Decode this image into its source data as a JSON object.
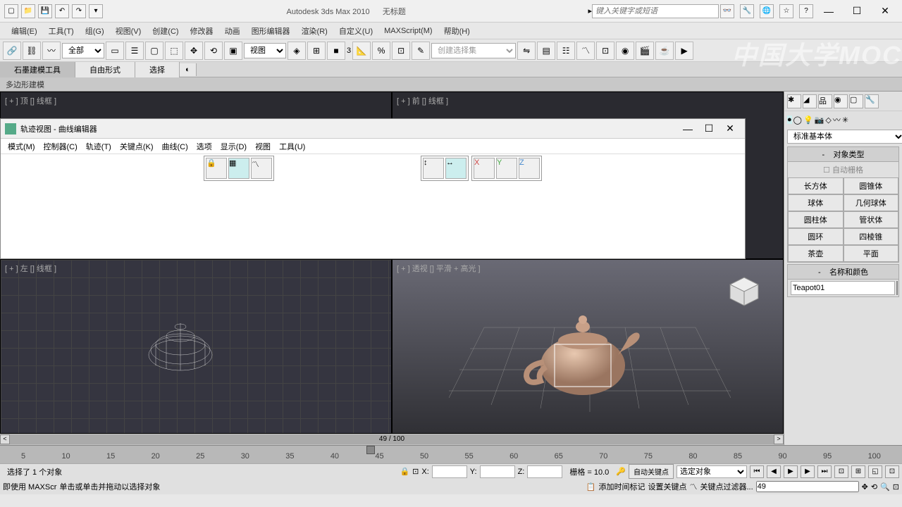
{
  "titlebar": {
    "app": "Autodesk 3ds Max  2010",
    "doc": "无标题",
    "search_placeholder": "键入关键字或短语"
  },
  "menu": {
    "edit": "编辑(E)",
    "tools": "工具(T)",
    "group": "组(G)",
    "views": "视图(V)",
    "create": "创建(C)",
    "modifiers": "修改器",
    "anim": "动画",
    "graph": "图形编辑器",
    "render": "渲染(R)",
    "custom": "自定义(U)",
    "maxscript": "MAXScript(M)",
    "help": "帮助(H)"
  },
  "toolbar": {
    "filter": "全部",
    "view_combo": "视图",
    "selset": "创建选择集"
  },
  "ribbon": {
    "tab1": "石墨建模工具",
    "tab2": "自由形式",
    "tab3": "选择",
    "sub": "多边形建模"
  },
  "viewports": {
    "top": "[ + ] 顶 [] 线框 ]",
    "front": "[ + ] 前 [] 线框 ]",
    "left": "[ + ] 左 [] 线框 ]",
    "persp": "[ + ] 透视 [] 平滑 + 高光 ]"
  },
  "curve_editor": {
    "title": "轨迹视图 - 曲线编辑器",
    "menu": {
      "mode": "模式(M)",
      "controller": "控制器(C)",
      "tracks": "轨迹(T)",
      "keys": "关键点(K)",
      "curves": "曲线(C)",
      "options": "选项",
      "display": "显示(D)",
      "view": "视图",
      "tools": "工具(U)"
    }
  },
  "time_scroll": "49 / 100",
  "right_panel": {
    "category": "标准基本体",
    "sec_objtype": "对象类型",
    "autogrid": "自动栅格",
    "primitives": {
      "box": "长方体",
      "cone": "圆锥体",
      "sphere": "球体",
      "geosphere": "几何球体",
      "cylinder": "圆柱体",
      "tube": "管状体",
      "torus": "圆环",
      "pyramid": "四棱锥",
      "teapot": "茶壶",
      "plane": "平面"
    },
    "sec_name": "名称和颜色",
    "obj_name": "Teapot01"
  },
  "timeline": {
    "ticks": [
      "5",
      "10",
      "15",
      "20",
      "25",
      "30",
      "35",
      "40",
      "45",
      "50",
      "55",
      "60",
      "65",
      "70",
      "75",
      "80",
      "85",
      "90",
      "95",
      "100"
    ]
  },
  "status": {
    "sel": "选择了 1 个对象",
    "x": "X:",
    "y": "Y:",
    "z": "Z:",
    "grid": "栅格 = 10.0",
    "autokey": "自动关键点",
    "selobj": "选定对象",
    "frame": "49"
  },
  "status2": {
    "maxscript": "即使用 MAXScr",
    "hint": "单击或单击并拖动以选择对象",
    "addtime": "添加时间标记",
    "setkey": "设置关键点",
    "keyfilter": "关键点过滤器..."
  },
  "watermark": "中国大学MOC"
}
